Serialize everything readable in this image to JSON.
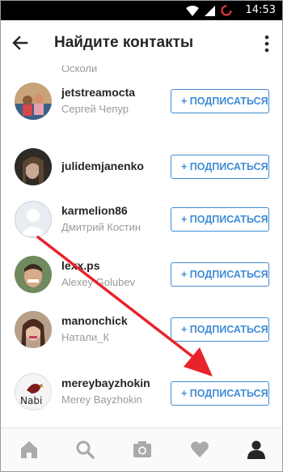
{
  "status": {
    "time": "14:53"
  },
  "header": {
    "title": "Найдите контакты"
  },
  "list": {
    "partial_name": "Осколи",
    "rows": [
      {
        "username": "jetstreamocta",
        "fullname": "Сергей Чепур",
        "button": "+ ПОДПИСАТЬСЯ"
      },
      {
        "username": "julidemjanenko",
        "fullname": "",
        "button": "+ ПОДПИСАТЬСЯ"
      },
      {
        "username": "karmelion86",
        "fullname": "Дмитрий Костин",
        "button": "+ ПОДПИСАТЬСЯ"
      },
      {
        "username": "lexx.ps",
        "fullname": "Alexey Golubev",
        "button": "+ ПОДПИСАТЬСЯ"
      },
      {
        "username": "manonchick",
        "fullname": "Натали_К",
        "button": "+ ПОДПИСАТЬСЯ"
      },
      {
        "username": "mereybayzhokin",
        "fullname": "Merey Bayzhokin",
        "button": "+ ПОДПИСАТЬСЯ"
      }
    ],
    "avatar_text_nabi": "Nabi"
  },
  "nav": {
    "items": [
      "home-icon",
      "search-icon",
      "camera-icon",
      "heart-icon",
      "profile-icon"
    ]
  },
  "colors": {
    "accent": "#3f8dd5",
    "arrow": "#e8232b"
  }
}
